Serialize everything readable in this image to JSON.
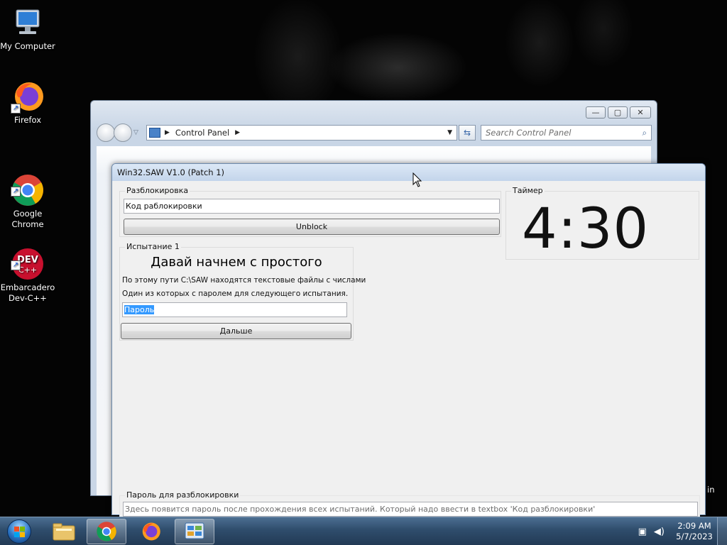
{
  "desktop": {
    "icons": [
      {
        "label": "My Computer"
      },
      {
        "label": "Firefox"
      },
      {
        "label": "Google\nChrome"
      },
      {
        "label": "Embarcadero\nDev-C++"
      }
    ],
    "edge_text": "in"
  },
  "control_panel": {
    "breadcrumb": "Control Panel",
    "search_placeholder": "Search Control Panel"
  },
  "saw": {
    "title": "Win32.SAW V1.0 (Patch 1)",
    "unblock_group": {
      "label": "Разблокировка",
      "code_field": "Код раблокировки",
      "unblock_button": "Unblock"
    },
    "timer_group": {
      "label": "Таймер",
      "value": "4:30"
    },
    "test_group": {
      "label": "Испытание 1",
      "heading": "Давай начнем с простого",
      "line1": "По этому пути C:\\SAW находятся текстовые файлы с числами",
      "line2": "Один из которых с паролем для следующего испытания.",
      "password_field": "Пароль",
      "next_button": "Дальше"
    },
    "password_group": {
      "label": "Пароль для разблокировки",
      "field": "Здесь появится пароль после прохождения всех испытаний. Который надо ввести в textbox 'Код разблокировки'"
    }
  },
  "taskbar": {
    "time": "2:09 AM",
    "date": "5/7/2023"
  }
}
